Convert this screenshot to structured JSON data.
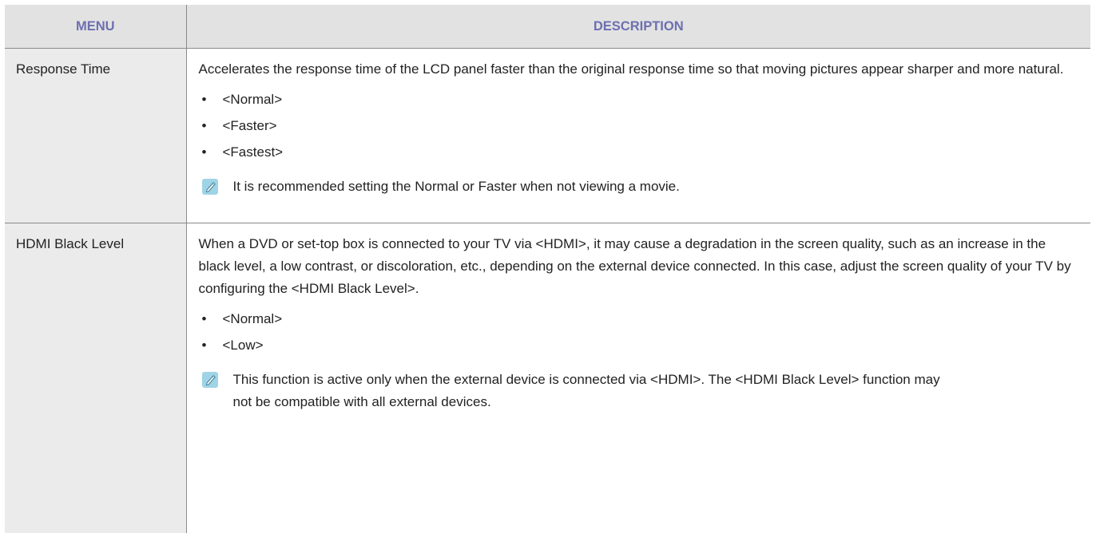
{
  "table": {
    "headers": {
      "menu": "MENU",
      "description": "DESCRIPTION"
    },
    "rows": [
      {
        "menu": "Response Time",
        "description": "Accelerates the response time of the LCD panel faster than the original response time so that moving pictures appear sharper and more natural.",
        "options": [
          "<Normal>",
          "<Faster>",
          "<Fastest>"
        ],
        "note": "It is recommended setting the Normal or Faster when not viewing a movie."
      },
      {
        "menu": "HDMI Black Level",
        "description": "When a DVD or set-top box is connected to your TV via <HDMI>, it may cause a degradation in the screen quality, such as an increase in the black level, a low contrast, or discoloration, etc., depending on the external device connected. In this case, adjust the screen quality of your TV by configuring the <HDMI Black Level>.",
        "options": [
          "<Normal>",
          "<Low>"
        ],
        "note": "This function is active only when the external device is connected via <HDMI>. The <HDMI Black Level> function may not be compatible with all external devices."
      }
    ],
    "bullet_glyph": "•",
    "note_icon": "pencil-note-icon",
    "colors": {
      "header_text": "#6d6fb0",
      "header_background": "#e2e2e2",
      "menu_cell_background": "#ebebeb",
      "note_icon_background": "#9fd4e6"
    }
  }
}
